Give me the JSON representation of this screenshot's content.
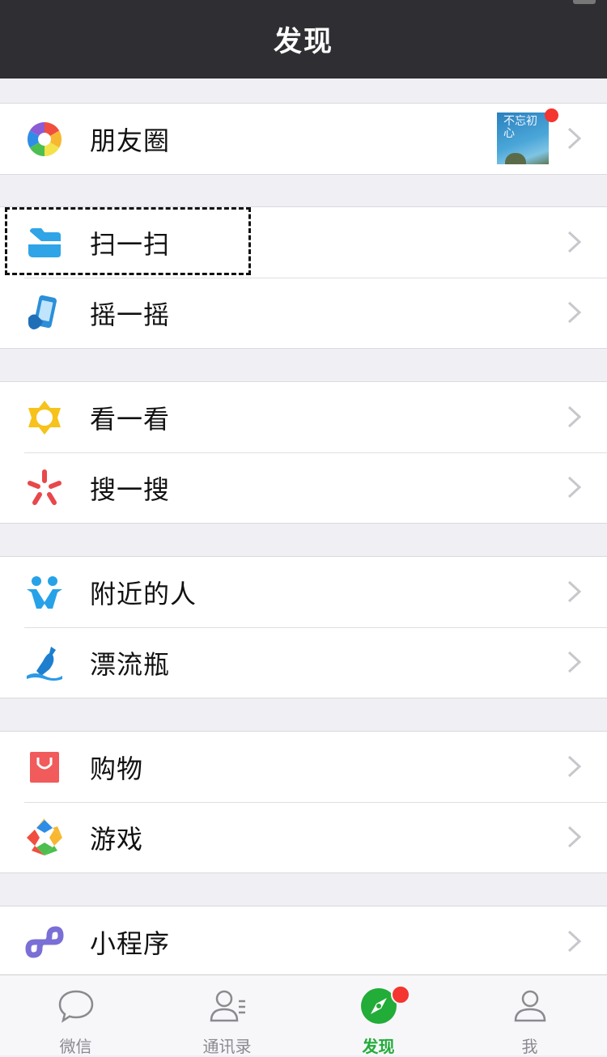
{
  "navbar": {
    "title": "发现"
  },
  "groups": [
    [
      {
        "label": "朋友圈",
        "icon": "moments-icon",
        "thumb_text": "不忘初心",
        "has_badge": true
      }
    ],
    [
      {
        "label": "扫一扫",
        "icon": "scan-icon",
        "focused": true
      },
      {
        "label": "摇一摇",
        "icon": "shake-icon"
      }
    ],
    [
      {
        "label": "看一看",
        "icon": "top-stories-icon"
      },
      {
        "label": "搜一搜",
        "icon": "search-icon"
      }
    ],
    [
      {
        "label": "附近的人",
        "icon": "people-nearby-icon"
      },
      {
        "label": "漂流瓶",
        "icon": "drift-bottle-icon"
      }
    ],
    [
      {
        "label": "购物",
        "icon": "shopping-bag-icon"
      },
      {
        "label": "游戏",
        "icon": "games-icon"
      }
    ],
    [
      {
        "label": "小程序",
        "icon": "mini-programs-icon"
      }
    ]
  ],
  "tabbar": {
    "tabs": [
      {
        "label": "微信",
        "icon": "chat-bubble-icon",
        "active": false
      },
      {
        "label": "通讯录",
        "icon": "contacts-icon",
        "active": false
      },
      {
        "label": "发现",
        "icon": "compass-icon",
        "active": true,
        "badge": true
      },
      {
        "label": "我",
        "icon": "person-icon",
        "active": false
      }
    ]
  },
  "colors": {
    "accent_green": "#22ac38",
    "badge_red": "#f43530",
    "navbar_bg": "#2f2f33"
  }
}
